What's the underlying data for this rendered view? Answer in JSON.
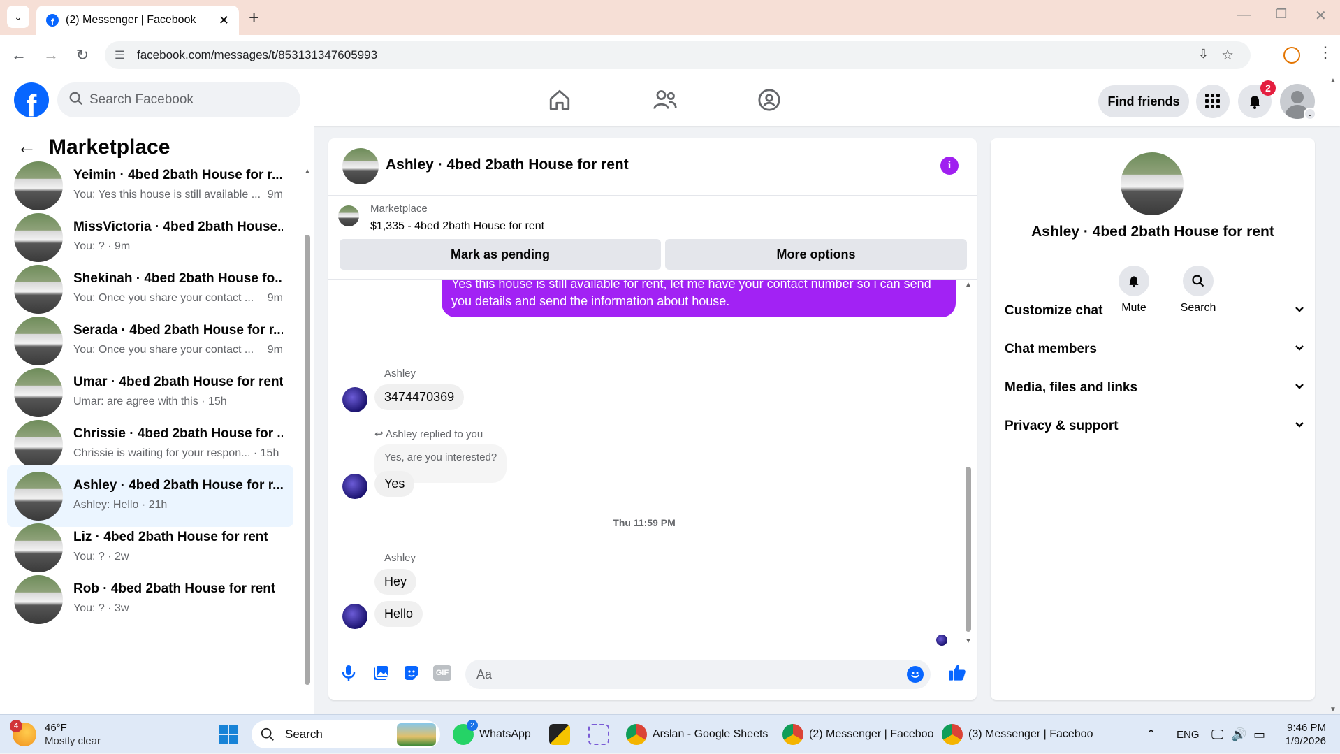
{
  "browser": {
    "tab_title": "(2) Messenger | Facebook",
    "url": "facebook.com/messages/t/853131347605993"
  },
  "fb": {
    "search_placeholder": "Search Facebook",
    "find_friends": "Find friends",
    "notif_count": "2"
  },
  "left": {
    "title": "Marketplace",
    "conversations": [
      {
        "title": "Yeimin · 4bed 2bath House for r...",
        "sub": "You: Yes this house is still available ...",
        "time": "9m"
      },
      {
        "title": "MissVictoria · 4bed 2bath House...",
        "sub": "You: ? · 9m",
        "time": ""
      },
      {
        "title": "Shekinah · 4bed 2bath House fo...",
        "sub": "You: Once you share your contact ...",
        "time": "9m"
      },
      {
        "title": "Serada · 4bed 2bath House for r...",
        "sub": "You: Once you share your contact ...",
        "time": "9m"
      },
      {
        "title": "Umar · 4bed 2bath House for rent",
        "sub": "Umar: are agree with this · 15h",
        "time": ""
      },
      {
        "title": "Chrissie · 4bed 2bath House for ...",
        "sub": "Chrissie is waiting for your respon... · 15h",
        "time": ""
      },
      {
        "title": "Ashley · 4bed 2bath House for r...",
        "sub": "Ashley: Hello · 21h",
        "time": ""
      },
      {
        "title": "Liz · 4bed 2bath House for rent",
        "sub": "You: ? · 2w",
        "time": ""
      },
      {
        "title": "Rob · 4bed 2bath House for rent",
        "sub": "You: ? · 3w",
        "time": ""
      }
    ]
  },
  "chat": {
    "header_title": "Ashley · 4bed 2bath House for rent",
    "listing_label": "Marketplace",
    "listing_price": "$1,335 - 4bed 2bath House for rent",
    "mark_pending": "Mark as pending",
    "more_options": "More options",
    "outgoing_msg": "Yes this house is still available for rent, let me have your contact number so i can send you details and send the information about house.",
    "sender1": "Ashley",
    "msg_phone": "3474470369",
    "replied_label": "Ashley replied to you",
    "quoted": "Yes, are you interested?",
    "msg_yes": "Yes",
    "timestamp": "Thu 11:59 PM",
    "sender2": "Ashley",
    "msg_hey": "Hey",
    "msg_hello": "Hello",
    "composer_placeholder": "Aa"
  },
  "right": {
    "name": "Ashley · 4bed 2bath House for rent",
    "mute": "Mute",
    "search": "Search",
    "sections": [
      "Customize chat",
      "Chat members",
      "Media, files and links",
      "Privacy & support"
    ]
  },
  "taskbar": {
    "weather_temp": "46°F",
    "weather_desc": "Mostly clear",
    "weather_badge": "4",
    "search": "Search",
    "whatsapp": "WhatsApp",
    "whatsapp_badge": "2",
    "sheets": "Arslan - Google Sheets",
    "messenger2": "(2) Messenger | Faceboo",
    "messenger3": "(3) Messenger | Faceboo",
    "lang": "ENG",
    "time": "9:46 PM",
    "date": "1/9/2026"
  }
}
